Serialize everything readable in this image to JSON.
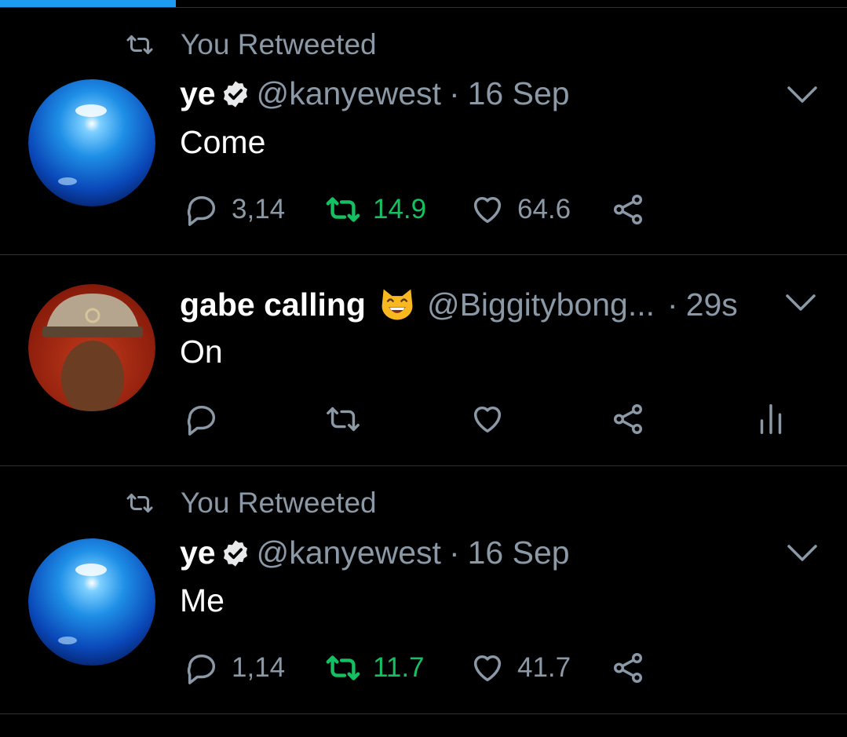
{
  "tweets": [
    {
      "retweet_label": "You Retweeted",
      "name": "ye",
      "handle": "@kanyewest",
      "separator": "·",
      "time": "16 Sep",
      "text": "Come",
      "replies": "3,14",
      "retweets": "14.9",
      "likes": "64.6",
      "retweeted": true,
      "verified": true
    },
    {
      "name": "gabe calling",
      "emoji": "smiling-cat-face-icon",
      "handle": "@Biggitybong...",
      "separator": "·",
      "time": "29s",
      "text": "On"
    },
    {
      "retweet_label": "You Retweeted",
      "name": "ye",
      "handle": "@kanyewest",
      "separator": "·",
      "time": "16 Sep",
      "text": "Me",
      "replies": "1,14",
      "retweets": "11.7",
      "likes": "41.7",
      "retweeted": true,
      "verified": true
    }
  ],
  "colors": {
    "background": "#000000",
    "secondary_text": "#8b98a5",
    "retweet_green": "#17bf63",
    "progress_blue": "#1d9bf0",
    "divider": "#2f3336"
  }
}
